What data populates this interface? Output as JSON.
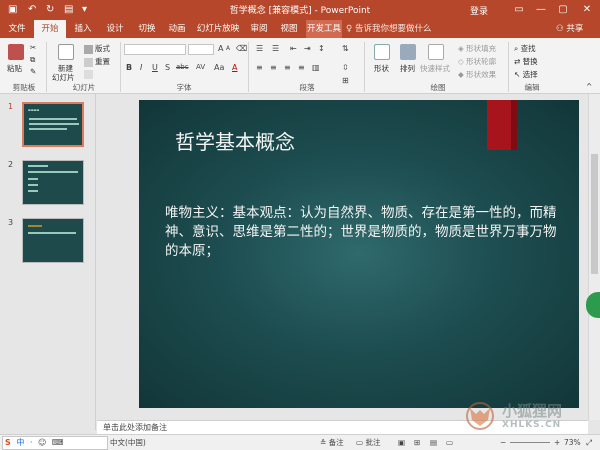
{
  "app": {
    "title": "哲学概念 [兼容模式] - PowerPoint",
    "login": "登录",
    "share": "共享",
    "colors": {
      "accent": "#b7472a",
      "slide_bg": "#1d4d50",
      "red_tab": "#a8141b"
    }
  },
  "tabs": [
    {
      "label": "文件"
    },
    {
      "label": "开始"
    },
    {
      "label": "插入"
    },
    {
      "label": "设计"
    },
    {
      "label": "切换"
    },
    {
      "label": "动画"
    },
    {
      "label": "幻灯片放映"
    },
    {
      "label": "审阅"
    },
    {
      "label": "视图"
    },
    {
      "label": "开发工具"
    }
  ],
  "tellme": "告诉我你想要做什么",
  "ribbon": {
    "clipboard": {
      "paste": "粘贴",
      "label": "剪贴板"
    },
    "slides": {
      "new_slide": "新建",
      "new_slide2": "幻灯片",
      "layout": "版式",
      "reset": "重置",
      "label": "幻灯片"
    },
    "font": {
      "label": "字体",
      "bold": "B",
      "italic": "I",
      "underline": "U",
      "strike": "S",
      "abc": "abc",
      "spacing": "AV",
      "case": "Aa",
      "color": "A"
    },
    "paragraph": {
      "label": "段落"
    },
    "drawing": {
      "shape": "形状",
      "arrange": "排列",
      "quick_styles": "快速样式",
      "fill": "形状填充",
      "outline": "形状轮廓",
      "effects": "形状效果",
      "label": "绘图"
    },
    "editing": {
      "find": "查找",
      "replace": "替换",
      "select": "选择",
      "label": "编辑"
    }
  },
  "slides_panel": [
    {
      "num": "1",
      "selected": true
    },
    {
      "num": "2",
      "selected": false
    },
    {
      "num": "3",
      "selected": false
    }
  ],
  "slide": {
    "title": "哲学基本概念",
    "body": "唯物主义：基本观点：认为自然界、物质、存在是第一性的，而精神、意识、思维是第二性的；世界是物质的，物质是世界万事万物的本原；"
  },
  "notes_placeholder": "单击此处添加备注",
  "status": {
    "language": "中文(中国)",
    "notes": "备注",
    "comments": "批注",
    "zoom": "73%",
    "ime": [
      "S",
      "中",
      "·",
      "☺",
      "⌨"
    ]
  },
  "watermark": {
    "cn": "小狐狸网",
    "en": "XHLKS.CN"
  }
}
